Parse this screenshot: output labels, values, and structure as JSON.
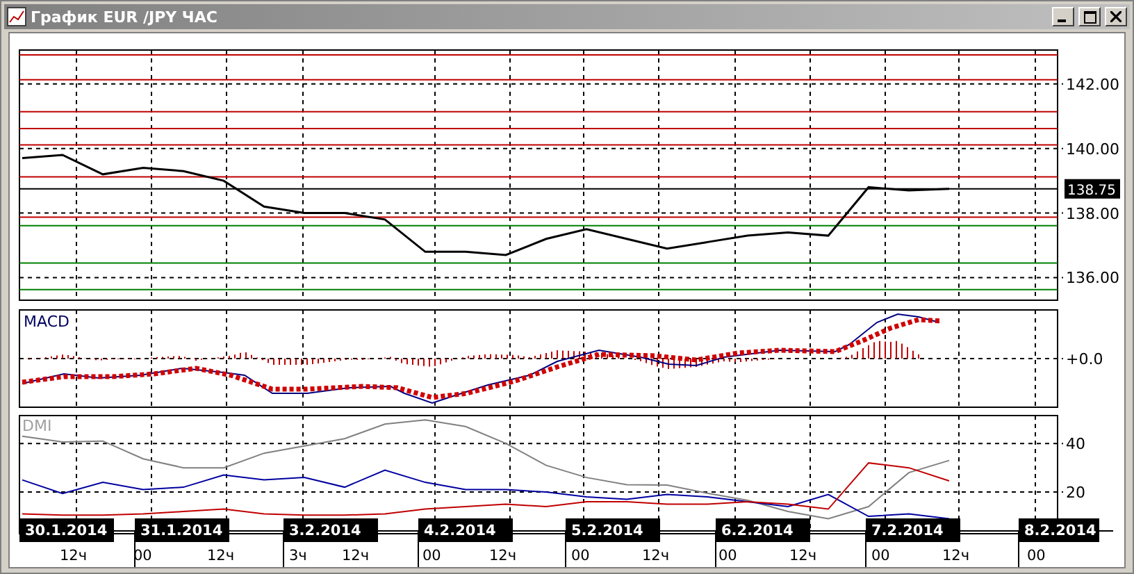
{
  "window": {
    "title": "График EUR /JPY  ЧАС"
  },
  "price_panel": {
    "chart_data": {
      "type": "line",
      "grid": true,
      "ylim": [
        135.3,
        143.05
      ],
      "yticks": [
        {
          "value": 136,
          "label": "136.00"
        },
        {
          "value": 138,
          "label": "138.00"
        },
        {
          "value": 140,
          "label": "140.00"
        },
        {
          "value": 142,
          "label": "142.00"
        }
      ],
      "series": [
        {
          "color": "#000000",
          "values": [
            139.7,
            139.8,
            139.2,
            139.4,
            139.3,
            139.0,
            138.2,
            138.0,
            138.0,
            137.8,
            136.8,
            136.8,
            136.7,
            137.2,
            137.5,
            137.2,
            136.9,
            137.1,
            137.3,
            137.4,
            137.3,
            138.8,
            138.7,
            138.75
          ]
        }
      ],
      "ref_lines": [
        {
          "axis": "y",
          "value": 142.9,
          "color": "#c00000"
        },
        {
          "axis": "y",
          "value": 142.13,
          "color": "#c00000"
        },
        {
          "axis": "y",
          "value": 141.14,
          "color": "#c00000"
        },
        {
          "axis": "y",
          "value": 140.62,
          "color": "#c00000"
        },
        {
          "axis": "y",
          "value": 140.11,
          "color": "#c00000"
        },
        {
          "axis": "y",
          "value": 139.12,
          "color": "#c00000"
        },
        {
          "axis": "y",
          "value": 137.87,
          "color": "#c00000"
        },
        {
          "axis": "y",
          "value": 137.61,
          "color": "#008000"
        },
        {
          "axis": "y",
          "value": 136.45,
          "color": "#008000"
        },
        {
          "axis": "y",
          "value": 135.63,
          "color": "#008000"
        },
        {
          "axis": "y",
          "value": 138.75,
          "color": "#000000",
          "label": "138.75"
        }
      ]
    }
  },
  "macd_panel": {
    "title": "MACD",
    "zero_label": "+0.0"
  },
  "dmi_panel": {
    "title": "DMI",
    "chart_data": {
      "type": "line",
      "grid": true,
      "ylim": [
        4,
        51.5
      ],
      "yticks": [
        20,
        40
      ],
      "series": [
        {
          "color": "#808080",
          "values": [
            43,
            40.6,
            41,
            33.7,
            30,
            30,
            36,
            39,
            42,
            48,
            49.7,
            47,
            40,
            31,
            26,
            23,
            22.9,
            19.5,
            16.6,
            12,
            9,
            14,
            28,
            33
          ]
        },
        {
          "color": "#0000a0",
          "values": [
            25,
            19.4,
            24,
            21,
            22,
            27,
            25,
            26,
            22,
            29,
            24,
            21,
            21,
            20,
            18,
            17,
            19,
            18,
            16,
            14,
            19,
            10,
            11,
            9
          ]
        },
        {
          "color": "#c00000",
          "values": [
            11,
            10.5,
            10.5,
            11,
            12,
            13,
            11,
            10.5,
            10.5,
            11,
            13,
            14,
            15,
            14,
            16,
            16,
            15,
            15,
            16,
            15,
            13,
            32,
            30,
            24.6
          ]
        }
      ]
    }
  },
  "time_axis": {
    "dates": [
      "30.1.2014",
      "31.1.2014",
      "3.2.2014",
      "4.2.2014",
      "5.2.2014",
      "6.2.2014",
      "7.2.2014",
      "8.2.2014"
    ],
    "hours": [
      "12ч",
      "00",
      "12ч",
      "3ч",
      "12ч",
      "00",
      "12ч",
      "00",
      "12ч",
      "00",
      "12ч",
      "00",
      "12ч",
      "00"
    ]
  }
}
